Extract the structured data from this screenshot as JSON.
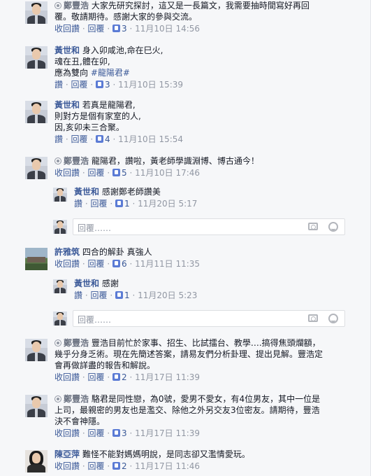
{
  "placeholder": "回覆……",
  "comments": [
    {
      "name": "鄭豐浩",
      "lines": [
        "大家先研究探討，這又是一長篇文，我需要抽時間寫好再回",
        "覆。敬請期待。感謝大家的參與交流。"
      ],
      "action1": "收回讚",
      "action2": "回覆",
      "likes": "3",
      "time": "11月10日 14:56"
    },
    {
      "name": "黃世和",
      "lines": [
        "身入卯咸池,命在巳火,",
        "魂在丑,體在卯,",
        "應為雙向 "
      ],
      "hashtag": "#龍陽君#",
      "action1": "讚",
      "action2": "回覆",
      "likes": "3",
      "time": "11月10日 15:39"
    },
    {
      "name": "黃世和",
      "lines": [
        "若真是龍陽君,",
        "則對方是個有家室的人,",
        "因,亥卯未三合聚。"
      ],
      "action1": "讚",
      "action2": "回覆",
      "likes": "4",
      "time": "11月10日 15:54"
    },
    {
      "name": "鄭豐浩",
      "lines": [
        "龍陽君，讚啦，黃老師學識淵博、博古通今！"
      ],
      "action1": "收回讚",
      "action2": "回覆",
      "likes": "5",
      "time": "11月10日 17:46"
    },
    {
      "name": "黃世和",
      "lines": [
        "感謝鄭老師讚美"
      ],
      "action1": "讚",
      "action2": "回覆",
      "likes": "1",
      "time": "11月20日 5:17"
    },
    {
      "name": "許雅筑",
      "lines": [
        "四合的解卦 真強人"
      ],
      "action1": "收回讚",
      "action2": "回覆",
      "likes": "6",
      "time": "11月11日 11:35"
    },
    {
      "name": "黃世和",
      "lines": [
        "感謝"
      ],
      "action1": "讚",
      "action2": "回覆",
      "likes": "1",
      "time": "11月20日 5:23"
    },
    {
      "name": "鄭豐浩",
      "lines": [
        "豐浩目前忙於家事、招生、比試擂台、教學….搞得焦頭爛額，",
        "幾乎分身乏術。現在先簡述答案，請易友們分析卦理、提出見解。豐浩定",
        "會再做詳盡的報告和解說。"
      ],
      "action1": "收回讚",
      "action2": "回覆",
      "likes": "2",
      "time": "11月17日 11:39"
    },
    {
      "name": "鄭豐浩",
      "lines": [
        "駱君是同性戀，為0號，愛男不愛女，有4位男友，其中一位是",
        "上司，最親密的男友也是濫交、除他之外另交友3位密友。請期待，豐浩",
        "決不會神隱。"
      ],
      "action1": "收回讚",
      "action2": "回覆",
      "likes": "3",
      "time": "11月17日 11:39"
    },
    {
      "name": "陳亞萍",
      "lines": [
        "難怪不能對媽媽明說，是同志卻又濫情愛玩。"
      ],
      "action1": "收回讚",
      "action2": "回覆",
      "likes": "2",
      "time": "11月17日 11:46"
    }
  ]
}
